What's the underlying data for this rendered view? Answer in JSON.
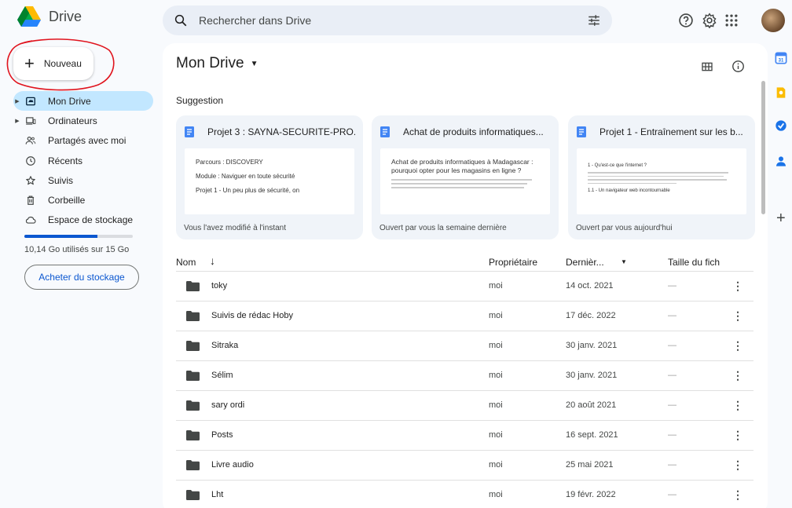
{
  "app": {
    "name": "Drive"
  },
  "search": {
    "placeholder": "Rechercher dans Drive"
  },
  "sidebar": {
    "new_label": "Nouveau",
    "items": [
      {
        "label": "Mon Drive",
        "icon": "drive-icon",
        "active": true
      },
      {
        "label": "Ordinateurs",
        "icon": "computer-icon"
      },
      {
        "label": "Partagés avec moi",
        "icon": "shared-icon"
      },
      {
        "label": "Récents",
        "icon": "clock-icon"
      },
      {
        "label": "Suivis",
        "icon": "star-icon"
      },
      {
        "label": "Corbeille",
        "icon": "trash-icon"
      },
      {
        "label": "Espace de stockage",
        "icon": "cloud-icon"
      }
    ],
    "storage_text": "10,14 Go utilisés sur 15 Go",
    "storage_fraction": 0.676,
    "buy_label": "Acheter du stockage"
  },
  "main": {
    "title": "Mon Drive",
    "suggestion_label": "Suggestion",
    "cards": [
      {
        "title": "Projet 3 : SAYNA-SECURITE-PRO...",
        "footer": "Vous l'avez modifié à l'instant",
        "preview": [
          "Parcours : DISCOVERY",
          "Module : Naviguer en toute sécurité",
          "Projet 1 - Un peu plus de sécurité, on"
        ]
      },
      {
        "title": "Achat de produits informatiques...",
        "footer": "Ouvert par vous la semaine dernière",
        "preview": [
          "Achat de produits informatiques à Madagascar : pourquoi opter pour les magasins en ligne ?"
        ]
      },
      {
        "title": "Projet 1 - Entraînement sur les b...",
        "footer": "Ouvert par vous aujourd'hui",
        "preview": [
          "1 - Qu'est-ce que l'internet ?",
          "1.1 - Un navigateur web incontournable"
        ]
      }
    ],
    "columns": {
      "name": "Nom",
      "owner": "Propriétaire",
      "modified": "Dernièr...",
      "size": "Taille du fich"
    },
    "rows": [
      {
        "name": "toky",
        "owner": "moi",
        "date": "14 oct. 2021",
        "size": "—"
      },
      {
        "name": "Suivis de rédac Hoby",
        "owner": "moi",
        "date": "17 déc. 2022",
        "size": "—"
      },
      {
        "name": "Sitraka",
        "owner": "moi",
        "date": "30 janv. 2021",
        "size": "—"
      },
      {
        "name": "Sélim",
        "owner": "moi",
        "date": "30 janv. 2021",
        "size": "—"
      },
      {
        "name": "sary ordi",
        "owner": "moi",
        "date": "20 août 2021",
        "size": "—"
      },
      {
        "name": "Posts",
        "owner": "moi",
        "date": "16 sept. 2021",
        "size": "—"
      },
      {
        "name": "Livre audio",
        "owner": "moi",
        "date": "25 mai 2021",
        "size": "—"
      },
      {
        "name": "Lht",
        "owner": "moi",
        "date": "19 févr. 2022",
        "size": "—"
      }
    ]
  },
  "colors": {
    "accent": "#0b57d0",
    "active_bg": "#c2e7ff",
    "annotation": "#e0141e"
  }
}
